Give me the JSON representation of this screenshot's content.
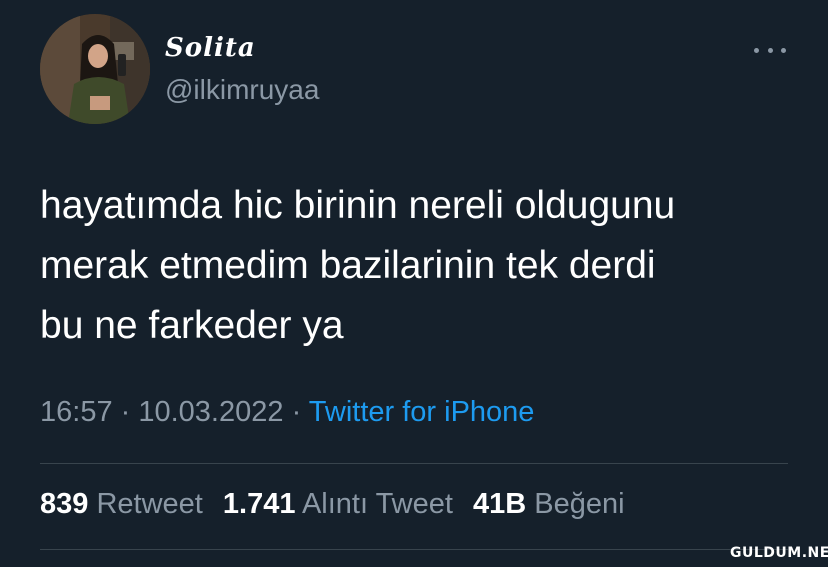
{
  "author": {
    "display_name": "Solita",
    "handle": "@ilkimruyaa"
  },
  "tweet": {
    "lines": [
      "hayatımda hic birinin nereli oldugunu",
      "merak etmedim bazilarinin tek derdi",
      "bu ne farkeder ya"
    ]
  },
  "meta": {
    "time": "16:57",
    "separator": " · ",
    "date": "10.03.2022",
    "source": "Twitter for iPhone"
  },
  "stats": {
    "retweets": {
      "count": "839",
      "label": "Retweet"
    },
    "quotes": {
      "count": "1.741",
      "label": "Alıntı Tweet"
    },
    "likes": {
      "count": "41B",
      "label": "Beğeni"
    }
  },
  "watermark": "GULDUM.NET",
  "colors": {
    "background": "#15202b",
    "secondary_text": "#8b98a5",
    "link": "#1d9bf0",
    "divider": "#38444d"
  }
}
